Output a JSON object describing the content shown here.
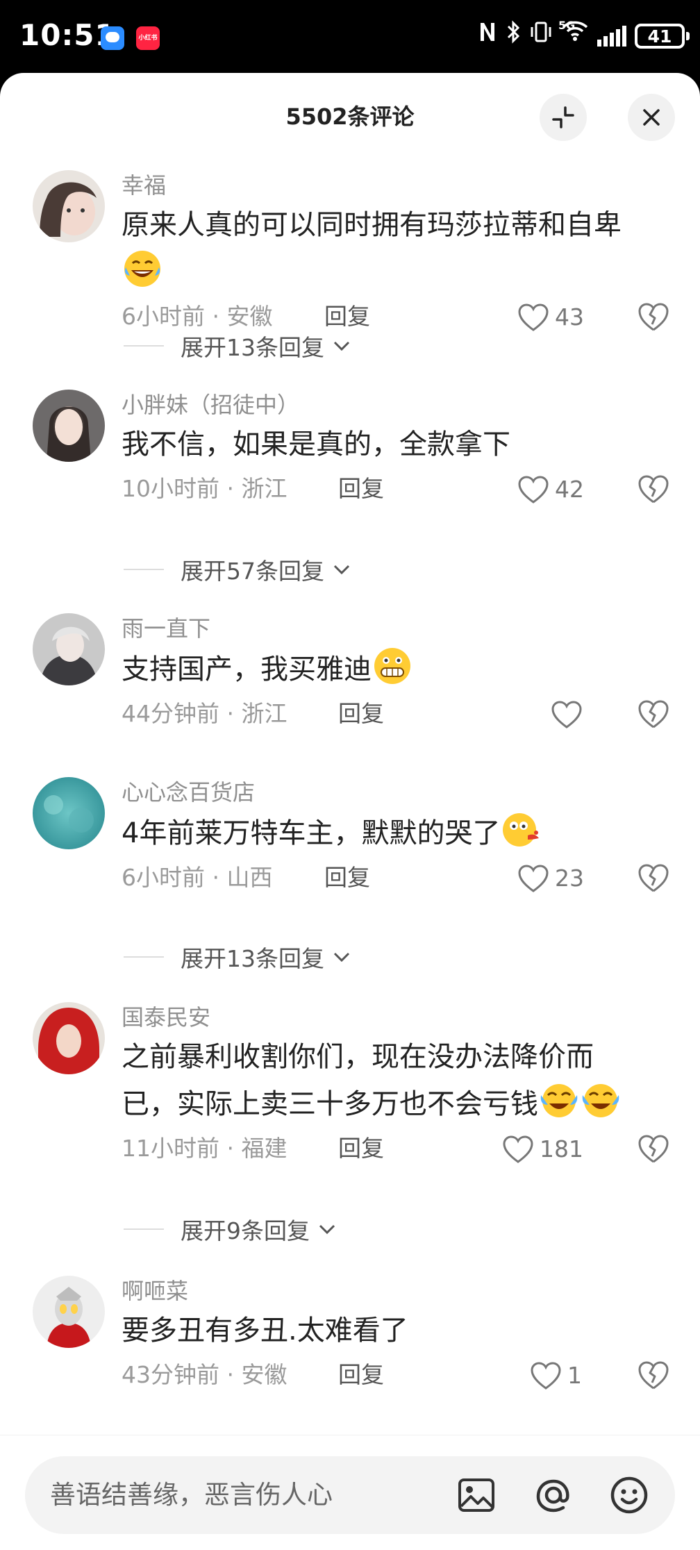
{
  "status_bar": {
    "time": "10:51",
    "app2_label": "小红书",
    "network": "5G",
    "battery": "41"
  },
  "panel": {
    "title": "5502条评论"
  },
  "comments": [
    {
      "username": "幸福",
      "text": "原来人真的可以同时拥有玛莎拉蒂和自卑",
      "emoji": "laughing-tears-emoji",
      "time_loc": "6小时前 · 安徽",
      "reply": "回复",
      "likes": "43",
      "expand": "展开13条回复"
    },
    {
      "username": "小胖妹（招徒中）",
      "text": "我不信，如果是真的，全款拿下",
      "time_loc": "10小时前 · 浙江",
      "reply": "回复",
      "likes": "42",
      "expand": "展开57条回复"
    },
    {
      "username": "雨一直下",
      "text": "支持国产，我买雅迪",
      "emoji": "grinning-teeth-emoji",
      "time_loc": "44分钟前 · 浙江",
      "reply": "回复",
      "likes": ""
    },
    {
      "username": "心心念百货店",
      "text": "4年前莱万特车主，默默的哭了",
      "emoji": "spitting-blood-emoji",
      "time_loc": "6小时前 · 山西",
      "reply": "回复",
      "likes": "23",
      "expand": "展开13条回复"
    },
    {
      "username": "国泰民安",
      "text_line1": "之前暴利收割你们，现在没办法降价而",
      "text_line2": "已，实际上卖三十多万也不会亏钱",
      "emoji": "crying-laughing-emoji",
      "time_loc": "11小时前 · 福建",
      "reply": "回复",
      "likes": "181",
      "expand": "展开9条回复"
    },
    {
      "username": "啊咂菜",
      "text": "要多丑有多丑.太难看了",
      "time_loc": "43分钟前 · 安徽",
      "reply": "回复",
      "likes": "1"
    }
  ],
  "input": {
    "placeholder": "善语结善缘，恶言伤人心"
  },
  "colors": {
    "like_icon": "#777777",
    "text_primary": "#222222",
    "text_secondary": "#8f8f8f"
  }
}
